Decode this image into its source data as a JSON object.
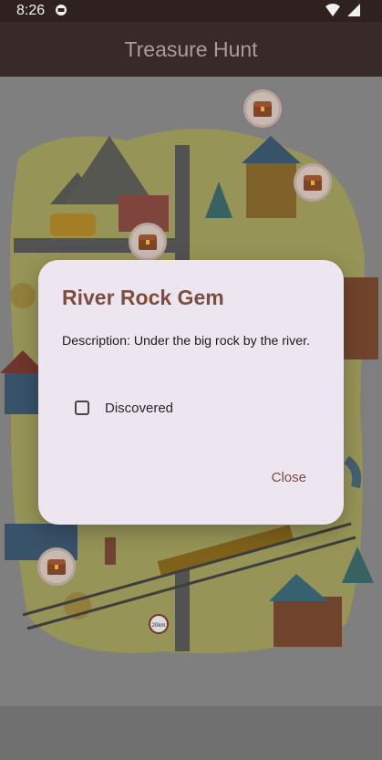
{
  "status_bar": {
    "time": "8:26"
  },
  "app_bar": {
    "title": "Treasure Hunt"
  },
  "dialog": {
    "title": "River Rock Gem",
    "description": "Description: Under the big rock by the river.",
    "checkbox": {
      "label": "Discovered",
      "checked": false
    },
    "close_label": "Close"
  },
  "map": {
    "sign_label": "20km"
  },
  "colors": {
    "status_bar": "#2f211f",
    "app_bar": "#382a28",
    "dialog_bg": "#ede5f0",
    "accent": "#7b4e3f"
  }
}
